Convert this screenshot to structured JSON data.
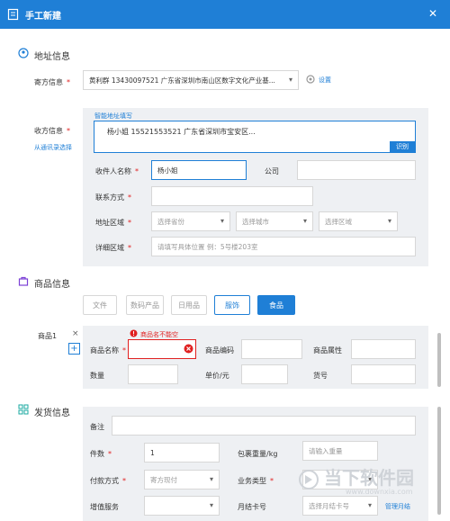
{
  "window": {
    "title": "手工新建",
    "close_glyph": "✕"
  },
  "address": {
    "section_title": "地址信息",
    "sender_label": "寄方信息",
    "sender_value": "黄利群 13430097521 广东省深圳市南山区数字文化产业基...",
    "settings_label": "设置",
    "receiver_label": "收方信息",
    "contacts_link": "从通讯录选择",
    "smart_label": "智能地址填写",
    "smart_text": "杨小姐 15521553521 广东省深圳市宝安区...",
    "recognize_button": "识别",
    "name_label": "收件人名称",
    "name_value": "杨小姐",
    "company_label": "公司",
    "contact_label": "联系方式",
    "region_label": "地址区域",
    "province_placeholder": "选择省份",
    "city_placeholder": "选择城市",
    "district_placeholder": "选择区域",
    "detail_label": "详细区域",
    "detail_placeholder": "请填写具体位置 例：5号楼203室"
  },
  "goods": {
    "section_title": "商品信息",
    "categories": [
      {
        "label": "文件",
        "state": "normal"
      },
      {
        "label": "数码产品",
        "state": "normal"
      },
      {
        "label": "日用品",
        "state": "normal"
      },
      {
        "label": "服饰",
        "state": "active"
      },
      {
        "label": "食品",
        "state": "primary"
      }
    ],
    "item_label": "商品1",
    "remove_glyph": "×",
    "add_glyph": "+",
    "error_text": "商品名不能空",
    "name_label": "商品名称",
    "code_label": "商品编码",
    "attr_label": "商品属性",
    "qty_label": "数量",
    "price_label": "单价/元",
    "sku_label": "货号"
  },
  "shipping": {
    "section_title": "发货信息",
    "note_label": "备注",
    "count_label": "件数",
    "count_value": "1",
    "weight_label": "包裹重量/kg",
    "weight_placeholder": "请输入重量",
    "pay_label": "付款方式",
    "pay_value": "寄方现付",
    "biz_label": "业务类型",
    "service_label": "增值服务",
    "monthly_label": "月结卡号",
    "monthly_placeholder": "选择月结卡号",
    "manage_link": "管理月结"
  },
  "watermark": {
    "brand": "当下软件园",
    "url": "www.downxia.com"
  },
  "colors": {
    "accent": "#1f7fd6",
    "required": "#e02020",
    "panel": "#eef0f3"
  }
}
